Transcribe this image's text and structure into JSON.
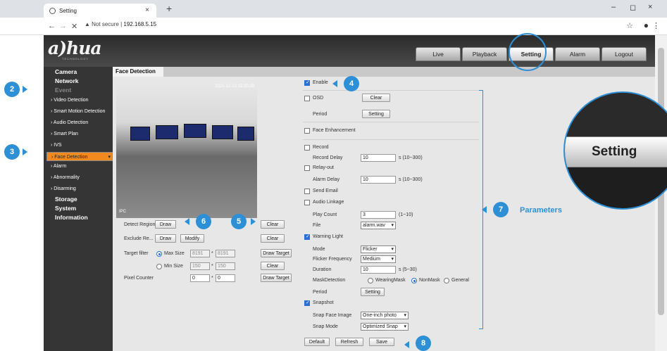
{
  "browser": {
    "tab_title": "Setting",
    "new_tab": "+",
    "address_warning": "▲ Not secure",
    "address_sep": "|",
    "address_url": "192.168.5.15"
  },
  "app": {
    "logo": "a)hua",
    "logo_sub": "TECHNOLOGY",
    "nav": [
      "Live",
      "Playback",
      "Setting",
      "Alarm",
      "Logout"
    ],
    "sidebar": {
      "camera": "Camera",
      "network": "Network",
      "event": "Event",
      "video_detection": "Video Detection",
      "smart_motion": "Smart Motion Detection",
      "audio_detection": "Audio Detection",
      "smart_plan": "Smart Plan",
      "ivs": "IVS",
      "face_detection": "Face Detection",
      "alarm": "Alarm",
      "abnormality": "Abnormality",
      "disarming": "Disarming",
      "storage": "Storage",
      "system": "System",
      "information": "Information"
    },
    "page_tab": "Face Detection",
    "video": {
      "timestamp": "2021-12-13 15:30:28",
      "channel": "IPC"
    },
    "left_controls": {
      "detect_region": "Detect Region",
      "exclude_region": "Exclude Re...",
      "draw": "Draw",
      "modify": "Modify",
      "clear": "Clear",
      "target_filter": "Target filter",
      "max_size": "Max Size",
      "min_size": "Min Size",
      "max_w": "8191",
      "max_h": "8191",
      "min_w": "150",
      "min_h": "150",
      "times": "*",
      "draw_target": "Draw Target",
      "pixel_counter": "Pixel Counter",
      "pc_w": "0",
      "pc_h": "0"
    },
    "params": {
      "enable": "Enable",
      "osd": "OSD",
      "clear": "Clear",
      "period": "Period",
      "setting": "Setting",
      "face_enhancement": "Face Enhancement",
      "record": "Record",
      "record_delay": "Record Delay",
      "record_delay_val": "10",
      "record_delay_unit": "s (10~300)",
      "relay_out": "Relay-out",
      "alarm_delay": "Alarm Delay",
      "alarm_delay_val": "10",
      "alarm_delay_unit": "s (10~300)",
      "send_email": "Send Email",
      "audio_linkage": "Audio Linkage",
      "play_count": "Play Count",
      "play_count_val": "3",
      "play_count_unit": "(1~10)",
      "file": "File",
      "file_val": "alarm.wav",
      "warning_light": "Warning Light",
      "mode": "Mode",
      "mode_val": "Flicker",
      "flicker_freq": "Flicker Frequency",
      "flicker_freq_val": "Medium",
      "duration": "Duration",
      "duration_val": "10",
      "duration_unit": "s (5~30)",
      "mask_detection": "MaskDetection",
      "wearing_mask": "WearingMask",
      "non_mask": "NonMask",
      "general": "General",
      "snapshot": "Snapshot",
      "snap_face_image": "Snap Face Image",
      "snap_face_image_val": "One-inch photo",
      "snap_mode": "Snap Mode",
      "snap_mode_val": "Optimized Snap"
    },
    "footer": {
      "default": "Default",
      "refresh": "Refresh",
      "save": "Save"
    }
  },
  "annotations": {
    "c2": "2",
    "c3": "3",
    "c4": "4",
    "c5": "5",
    "c6": "6",
    "c7": "7",
    "c8": "8",
    "parameters": "Parameters",
    "zoom_label": "Setting"
  },
  "colors": {
    "accent": "#2d8fd6",
    "selected": "#f08a1e"
  }
}
